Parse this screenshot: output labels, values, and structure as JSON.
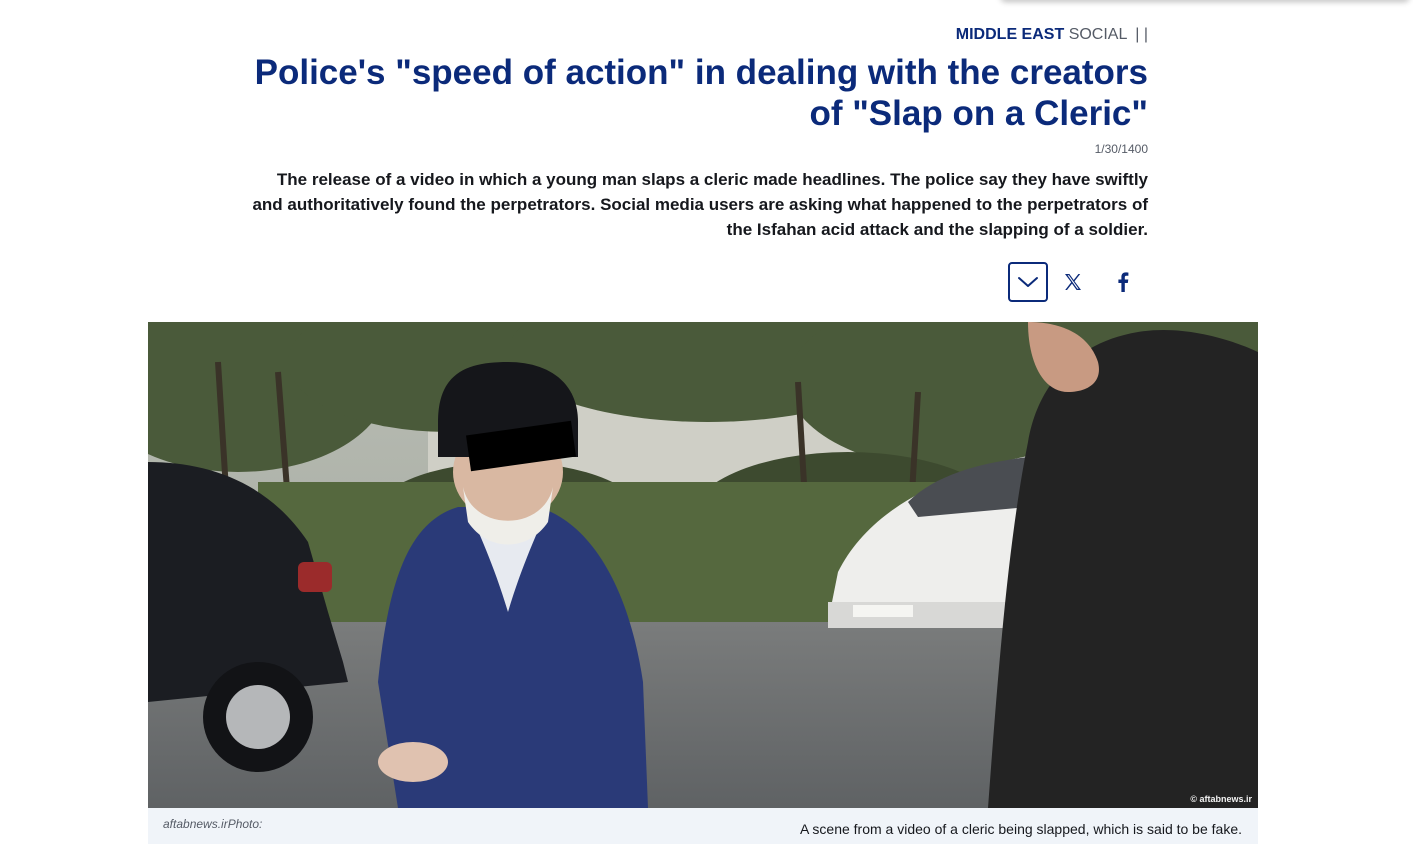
{
  "article": {
    "kicker": {
      "region": "MIDDLE EAST",
      "category": "SOCIAL",
      "separators": "|  |"
    },
    "headline": "Police's \"speed of action\" in dealing with the creators of \"Slap on a Cleric\"",
    "date": "1/30/1400",
    "teaser": "The release of a video in which a young man slaps a cleric made headlines. The police say they have swiftly and authoritatively found the perpetrators. Social media users are asking what happened to the perpetrators of the Isfahan acid attack and the slapping of a soldier."
  },
  "share": {
    "toggle_icon": "chevron-down-icon",
    "buttons": [
      {
        "icon": "x-logo-icon",
        "glyph": "𝕏"
      },
      {
        "icon": "facebook-icon",
        "glyph": "f"
      }
    ]
  },
  "photo": {
    "watermark": "© aftabnews.ir",
    "credit": "aftabnews.irPhoto:",
    "caption": "A scene from a video of a cleric being slapped, which is said to be fake."
  },
  "colors": {
    "brand": "#0b2a7a",
    "caption_bg": "#f0f4f9",
    "text": "#16181d",
    "muted": "#555b66"
  }
}
